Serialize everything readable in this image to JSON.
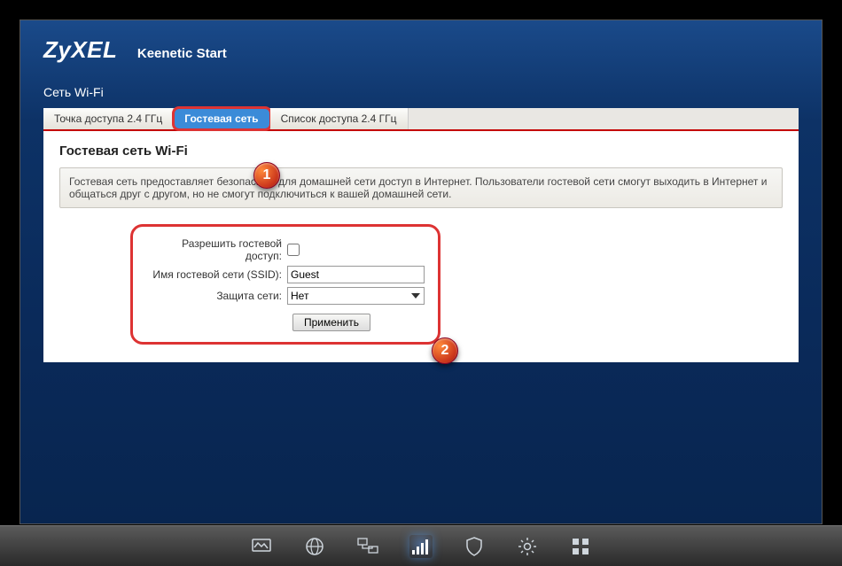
{
  "brand": "ZyXEL",
  "model": "Keenetic Start",
  "page_title": "Сеть Wi-Fi",
  "tabs": [
    {
      "label": "Точка доступа 2.4 ГГц",
      "active": false
    },
    {
      "label": "Гостевая сеть",
      "active": true
    },
    {
      "label": "Список доступа 2.4 ГГц",
      "active": false
    }
  ],
  "panel": {
    "heading": "Гостевая сеть Wi-Fi",
    "description": "Гостевая сеть предоставляет безопасный для домашней сети доступ в Интернет. Пользователи гостевой сети смогут выходить в Интернет и общаться друг с другом, но не смогут подключиться к вашей домашней сети."
  },
  "form": {
    "enable_label": "Разрешить гостевой доступ:",
    "enable_checked": false,
    "ssid_label": "Имя гостевой сети (SSID):",
    "ssid_value": "Guest",
    "security_label": "Защита сети:",
    "security_value": "Нет",
    "apply_label": "Применить"
  },
  "callouts": {
    "one": "1",
    "two": "2"
  }
}
